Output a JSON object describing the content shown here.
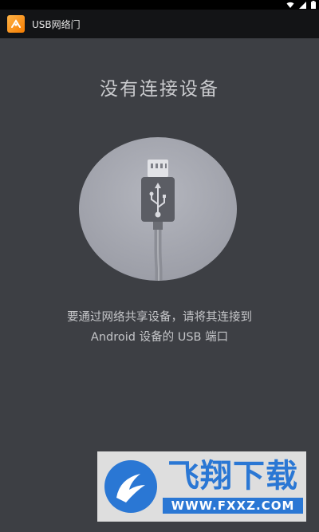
{
  "status_bar": {
    "icons": [
      "wifi-icon",
      "signal-icon",
      "battery-icon"
    ]
  },
  "app_bar": {
    "icon": "app-logo-icon",
    "title": "USB网络门"
  },
  "main": {
    "heading": "没有连接设备",
    "illustration": "usb-cable-icon",
    "message_line_1": "要通过网络共享设备，请将其连接到",
    "message_line_2": "Android 设备的 USB 端口"
  },
  "watermark": {
    "brand": "飞翔下载",
    "url": "WWW.FXXZ.COM"
  },
  "colors": {
    "background": "#3d3f44",
    "app_bar": "#131416",
    "circle": "#a9abb3",
    "watermark_blue": "#2a77d4"
  }
}
